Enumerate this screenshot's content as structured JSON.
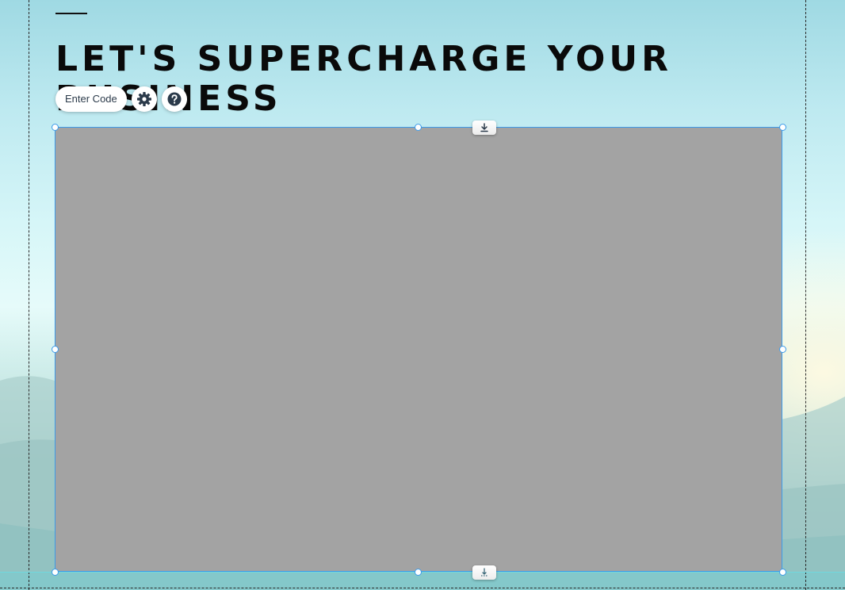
{
  "page": {
    "heading": "LET'S SUPERCHARGE YOUR BUSINESS"
  },
  "toolbar": {
    "enter_code_label": "Enter Code",
    "settings_icon": "gear-icon",
    "help_icon": "question-mark-icon"
  },
  "selection": {
    "accent_color": "#3d9be9",
    "top_handle_icon": "download-arrow-icon",
    "bottom_handle_icon": "anchor-arrow-icon"
  },
  "colors": {
    "placeholder_fill": "#a3a3a3",
    "heading_text": "#0a0a0a",
    "guide_line": "#6fd8de"
  }
}
